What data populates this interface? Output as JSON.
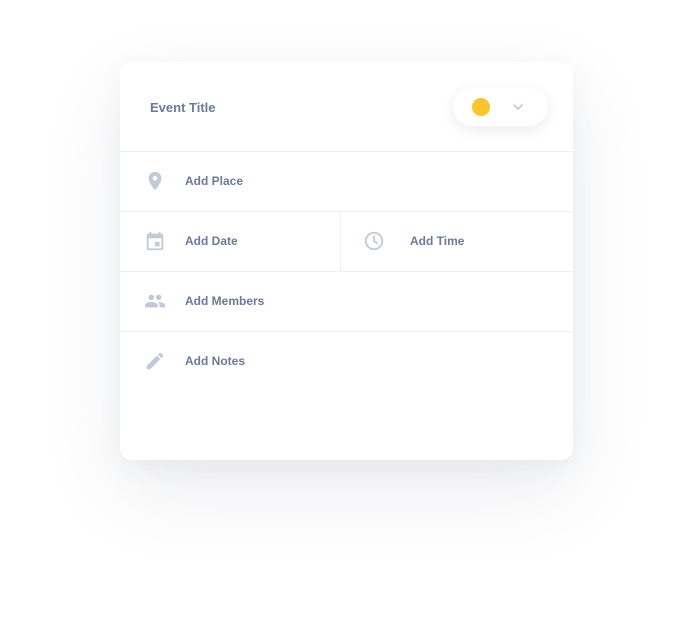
{
  "card": {
    "title": "Event Title",
    "color_picker": {
      "selected_color": "#fdc42b",
      "icon": "chevron-down-icon"
    },
    "fields": {
      "place": {
        "label": "Add Place",
        "icon": "location-pin-icon"
      },
      "date": {
        "label": "Add Date",
        "icon": "calendar-icon"
      },
      "time": {
        "label": "Add Time",
        "icon": "clock-icon"
      },
      "members": {
        "label": "Add Members",
        "icon": "people-icon"
      },
      "notes": {
        "label": "Add Notes",
        "icon": "pencil-icon"
      }
    }
  },
  "colors": {
    "icon": "#c2c9d8",
    "text": "#6b7a99",
    "divider": "#eef0f4"
  }
}
